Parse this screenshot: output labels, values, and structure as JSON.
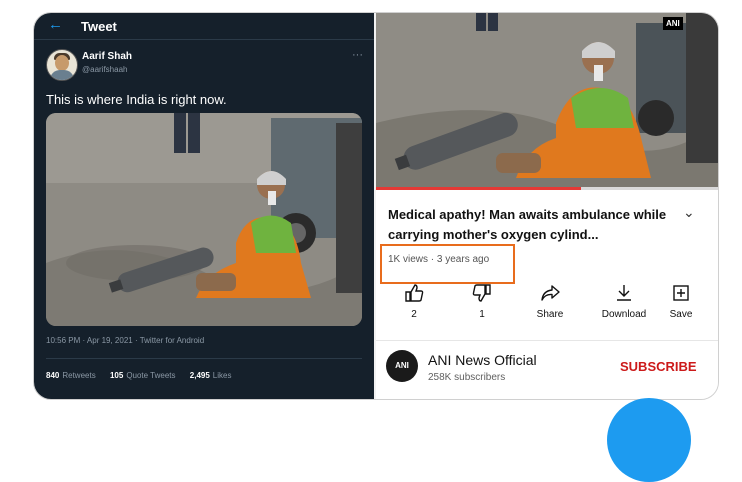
{
  "twitter": {
    "header_title": "Tweet",
    "author_name": "Aarif Shah",
    "author_handle": "@aarifshaah",
    "tweet_text": "This is where India is right now.",
    "meta": "10:56 PM · Apr 19, 2021 · Twitter for Android",
    "stats": {
      "retweets_count": "840",
      "retweets_label": "Retweets",
      "quotes_count": "105",
      "quotes_label": "Quote Tweets",
      "likes_count": "2,495",
      "likes_label": "Likes"
    },
    "accent_color": "#1d9bf0",
    "background_color": "#15202b"
  },
  "youtube": {
    "badge": "ANI",
    "video_title": "Medical apathy! Man awaits ambulance while carrying mother's oxygen cylind...",
    "views": "1K views · 3 years ago",
    "progress_fraction": 0.6,
    "actions": [
      {
        "icon": "thumbs-up-icon",
        "label": "2"
      },
      {
        "icon": "thumbs-down-icon",
        "label": "1"
      },
      {
        "icon": "share-icon",
        "label": "Share"
      },
      {
        "icon": "download-icon",
        "label": "Download"
      },
      {
        "icon": "save-icon",
        "label": "Save"
      }
    ],
    "channel_logo_text": "ANI",
    "channel_name": "ANI News Official",
    "subscribers": "258K subscribers",
    "subscribe_label": "SUBSCRIBE",
    "subscribe_color": "#cc1a1a",
    "highlight_color": "#e86c1d"
  }
}
